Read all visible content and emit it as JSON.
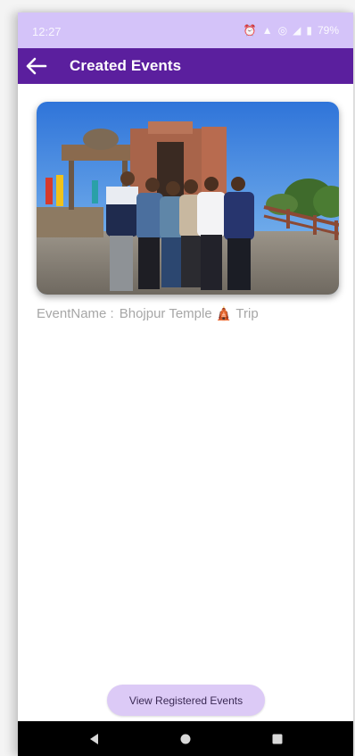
{
  "status_bar": {
    "time": "12:27",
    "battery": "79%",
    "icons": [
      "alarm-icon",
      "signal-icon",
      "hotspot-icon",
      "network-icon",
      "battery-icon"
    ]
  },
  "app_bar": {
    "title": "Created Events",
    "back_icon": "arrow-left-icon",
    "color": "#5b1f9e"
  },
  "events": [
    {
      "label": "EventName :",
      "name": "Bhojpur Temple 🛕 Trip"
    }
  ],
  "footer": {
    "view_button_label": "View Registered Events"
  },
  "nav_bar": {
    "items": [
      "back-triangle-icon",
      "home-circle-icon",
      "recents-square-icon"
    ]
  }
}
